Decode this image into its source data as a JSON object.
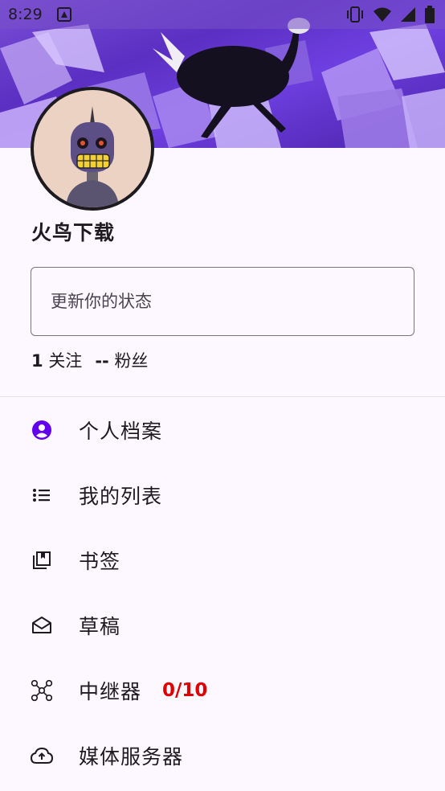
{
  "status_bar": {
    "time": "8:29"
  },
  "profile": {
    "display_name": "火鸟下载",
    "status_placeholder": "更新你的状态",
    "following_count": "1",
    "following_label": "关注",
    "followers_count": "--",
    "followers_label": "粉丝"
  },
  "menu": {
    "items": [
      {
        "label": "个人档案",
        "icon": "account-circle-icon"
      },
      {
        "label": "我的列表",
        "icon": "list-icon"
      },
      {
        "label": "书签",
        "icon": "bookmarks-icon"
      },
      {
        "label": "草稿",
        "icon": "drafts-icon"
      },
      {
        "label": "中继器",
        "icon": "relay-hub-icon",
        "badge": "0/10"
      },
      {
        "label": "媒体服务器",
        "icon": "cloud-upload-icon"
      }
    ]
  },
  "colors": {
    "accent": "#6200ee",
    "badge": "#e00000",
    "background": "#fdf7ff"
  }
}
